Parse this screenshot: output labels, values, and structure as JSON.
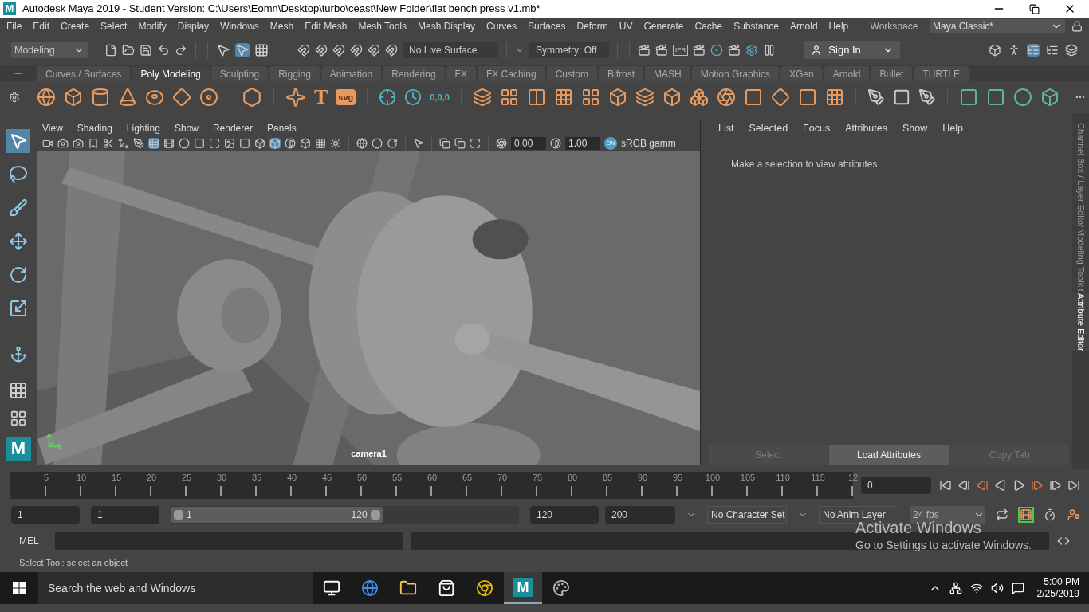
{
  "window": {
    "logo_letter": "M",
    "title": "Autodesk Maya 2019 - Student Version: C:\\Users\\Eomn\\Desktop\\turbo\\ceast\\New Folder\\flat bench press v1.mb*"
  },
  "menu": [
    "File",
    "Edit",
    "Create",
    "Select",
    "Modify",
    "Display",
    "Windows",
    "Mesh",
    "Edit Mesh",
    "Mesh Tools",
    "Mesh Display",
    "Curves",
    "Surfaces",
    "Deform",
    "UV",
    "Generate",
    "Cache",
    "Substance",
    "Arnold",
    "Help"
  ],
  "workspace": {
    "label": "Workspace :",
    "value": "Maya Classic*"
  },
  "status_line": {
    "menu_set": "Modeling",
    "live_surface": "No Live Surface",
    "symmetry": "Symmetry: Off",
    "ipr_label": "IPR",
    "sign_in": "Sign In",
    "pick_modes": [
      {
        "selected": false
      },
      {
        "selected": true
      },
      {
        "selected": false
      }
    ]
  },
  "shelf_tabs": [
    {
      "label": "Curves / Surfaces",
      "selected": false
    },
    {
      "label": "Poly Modeling",
      "selected": true
    },
    {
      "label": "Sculpting",
      "selected": false
    },
    {
      "label": "Rigging",
      "selected": false
    },
    {
      "label": "Animation",
      "selected": false
    },
    {
      "label": "Rendering",
      "selected": false
    },
    {
      "label": "FX",
      "selected": false
    },
    {
      "label": "FX Caching",
      "selected": false
    },
    {
      "label": "Custom",
      "selected": false
    },
    {
      "label": "Bifrost",
      "selected": false
    },
    {
      "label": "MASH",
      "selected": false
    },
    {
      "label": "Motion Graphics",
      "selected": false
    },
    {
      "label": "XGen",
      "selected": false
    },
    {
      "label": "Arnold",
      "selected": false
    },
    {
      "label": "Bullet",
      "selected": false
    },
    {
      "label": "TURTLE",
      "selected": false
    }
  ],
  "shelf_labels": {
    "type": "T",
    "svg": "svg",
    "origin": "0,0,0"
  },
  "toolbox_logo": "M",
  "toolbox": [
    {
      "selected": true
    },
    {
      "selected": false
    },
    {
      "selected": false
    },
    {
      "selected": false
    },
    {
      "selected": false
    },
    {
      "selected": false
    }
  ],
  "viewport": {
    "menu": [
      "View",
      "Shading",
      "Lighting",
      "Show",
      "Renderer",
      "Panels"
    ],
    "toolbar": [
      {
        "selected": false
      },
      {
        "selected": false
      },
      {
        "selected": false
      },
      {
        "selected": false
      },
      {
        "selected": false
      },
      {
        "selected": false
      },
      {
        "selected": false
      },
      {
        "selected": true
      },
      {
        "selected": false
      },
      {
        "selected": false
      },
      {
        "selected": false
      },
      {
        "selected": false
      },
      {
        "selected": false
      },
      {
        "selected": false
      },
      {
        "selected": false
      },
      {
        "selected": true
      },
      {
        "selected": false
      },
      {
        "selected": false
      },
      {
        "selected": false
      },
      {
        "selected": false
      }
    ],
    "exposure": "0.00",
    "gamma": "1.00",
    "color_toggle": "ON",
    "color_space": "sRGB gamm",
    "camera": "camera1"
  },
  "attribute_editor": {
    "menu": [
      "List",
      "Selected",
      "Focus",
      "Attributes",
      "Show",
      "Help"
    ],
    "message": "Make a selection to view attributes",
    "buttons": [
      {
        "label": "Select",
        "disabled": true
      },
      {
        "label": "Load Attributes",
        "disabled": false
      },
      {
        "label": "Copy Tab",
        "disabled": true
      }
    ]
  },
  "side_tabs": [
    {
      "label": "Channel Box / Layer Editor",
      "selected": false
    },
    {
      "label": "Modeling Toolkit",
      "selected": false
    },
    {
      "label": "Attribute Editor",
      "selected": true
    }
  ],
  "time_slider": {
    "ticks": [
      "5",
      "10",
      "15",
      "20",
      "25",
      "30",
      "35",
      "40",
      "45",
      "50",
      "55",
      "60",
      "65",
      "70",
      "75",
      "80",
      "85",
      "90",
      "95",
      "100",
      "105",
      "110",
      "115",
      "12"
    ],
    "current_frame": "0"
  },
  "range": {
    "start": "1",
    "playback_start": "1",
    "slider_start": "1",
    "slider_end": "120",
    "level": 0.61,
    "playback_end": "120",
    "end": "200",
    "character_set": "No Character Set",
    "anim_layer": "No Anim Layer",
    "fps": "24 fps"
  },
  "command_line": {
    "language": "MEL"
  },
  "help_line": "Select Tool: select an object",
  "activation_notice": {
    "title": "Activate Windows",
    "body": "Go to Settings to activate Windows."
  },
  "taskbar": {
    "search": "Search the web and Windows",
    "time": "5:00 PM",
    "date": "2/25/2019",
    "apps": [
      {
        "kind": "taskview",
        "active": false
      },
      {
        "kind": "edge",
        "active": false
      },
      {
        "kind": "explorer",
        "active": false
      },
      {
        "kind": "store",
        "active": false
      },
      {
        "kind": "chrome",
        "active": false
      },
      {
        "kind": "maya",
        "active": true,
        "letter": "M"
      },
      {
        "kind": "paint",
        "active": false
      }
    ]
  }
}
